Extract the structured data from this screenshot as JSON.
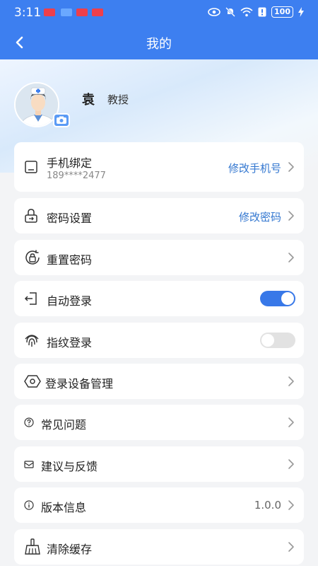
{
  "status_bar": {
    "time": "3:11",
    "battery": "100"
  },
  "header": {
    "title": "我的"
  },
  "profile": {
    "name": "袁",
    "role": "教授"
  },
  "menu": {
    "phone": {
      "label": "手机绑定",
      "number": "189****2477",
      "action": "修改手机号"
    },
    "password": {
      "label": "密码设置",
      "action": "修改密码"
    },
    "reset": {
      "label": "重置密码"
    },
    "auto_login": {
      "label": "自动登录",
      "enabled": true
    },
    "fingerprint": {
      "label": "指纹登录",
      "enabled": false
    },
    "devices": {
      "label": "登录设备管理"
    },
    "faq": {
      "label": "常见问题"
    },
    "feedback": {
      "label": "建议与反馈"
    },
    "version": {
      "label": "版本信息",
      "value": "1.0.0"
    },
    "cache": {
      "label": "清除缓存"
    }
  },
  "colors": {
    "primary": "#3d7ff0",
    "link": "#3377d0",
    "toggle_on": "#3878e8",
    "toggle_off": "#e2e2e2"
  }
}
